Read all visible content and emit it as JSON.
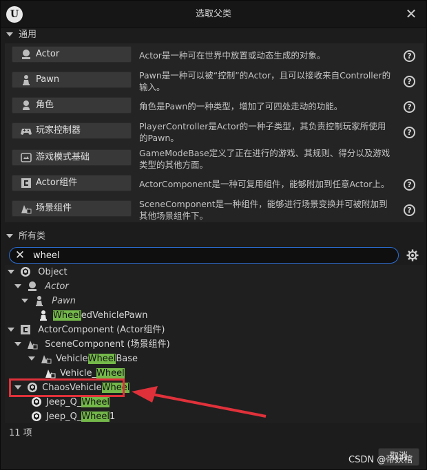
{
  "window": {
    "title": "选取父类",
    "logo_text": "U",
    "close_glyph": "✕"
  },
  "common": {
    "header": "通用",
    "items": [
      {
        "label": "Actor",
        "icon": "actor-icon",
        "desc": "Actor是一种可在世界中放置或动态生成的对象。"
      },
      {
        "label": "Pawn",
        "icon": "pawn-icon",
        "desc": "Pawn是一种可以被“控制”的Actor，且可以接收来自Controller的输入。"
      },
      {
        "label": "角色",
        "icon": "character-icon",
        "desc": "角色是Pawn的一种类型，增加了可四处走动的功能。"
      },
      {
        "label": "玩家控制器",
        "icon": "gamepad-icon",
        "desc": "PlayerController是Actor的一种子类型，其负责控制玩家所使用的Pawn。"
      },
      {
        "label": "游戏模式基础",
        "icon": "game-mode-icon",
        "desc": "GameModeBase定义了正在进行的游戏、其规则、得分以及游戏类型的其他方面。"
      },
      {
        "label": "Actor组件",
        "icon": "actor-component-icon",
        "desc": "ActorComponent是一种可复用组件，能够附加到任意Actor上。"
      },
      {
        "label": "场景组件",
        "icon": "scene-component-icon",
        "desc": "SceneComponent是一种组件，能够进行场景变换并可被附加到其他场景组件下。"
      }
    ],
    "help_glyph": "?"
  },
  "all_classes": {
    "header": "所有类",
    "search_value": "wheel",
    "tree": [
      {
        "pre": "Object",
        "hl": "",
        "post": ""
      },
      {
        "pre": "Actor",
        "hl": "",
        "post": ""
      },
      {
        "pre": "Pawn",
        "hl": "",
        "post": ""
      },
      {
        "pre": "",
        "hl": "Wheel",
        "post": "edVehiclePawn"
      },
      {
        "pre": "ActorComponent (Actor组件)",
        "hl": "",
        "post": ""
      },
      {
        "pre": "SceneComponent (场景组件)",
        "hl": "",
        "post": ""
      },
      {
        "pre": "Vehicle",
        "hl": "Wheel",
        "post": "Base"
      },
      {
        "pre": "Vehicle_",
        "hl": "Wheel",
        "post": ""
      },
      {
        "pre": "ChaosVehicle",
        "hl": "Wheel",
        "post": ""
      },
      {
        "pre": "Jeep_Q_",
        "hl": "Wheel",
        "post": ""
      },
      {
        "pre": "Jeep_Q_",
        "hl": "Wheel",
        "post": "1"
      }
    ]
  },
  "footer": {
    "count": "11 项",
    "cancel_label": "取消",
    "watermark": "CSDN @帝妖棺"
  },
  "colors": {
    "accent": "#2c6fd6",
    "match_highlight": "#74b84a",
    "annotation_red": "#e0313a"
  }
}
